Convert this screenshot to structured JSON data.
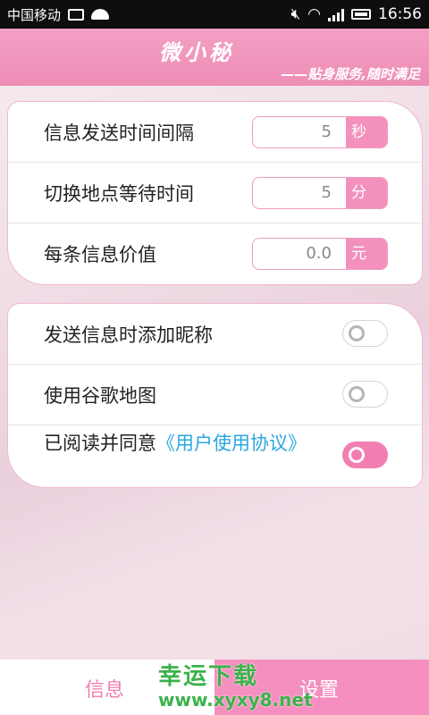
{
  "status_bar": {
    "carrier": "中国移动",
    "time": "16:56"
  },
  "header": {
    "brand": "微小秘",
    "slogan": "——贴身服务,随时满足"
  },
  "intervals": [
    {
      "label": "信息发送时间间隔",
      "value": "5",
      "unit": "秒"
    },
    {
      "label": "切换地点等待时间",
      "value": "5",
      "unit": "分"
    },
    {
      "label": "每条信息价值",
      "value": "0.0",
      "unit": "元"
    }
  ],
  "options": [
    {
      "label": "发送信息时添加昵称",
      "enabled": false
    },
    {
      "label": "使用谷歌地图",
      "enabled": false
    }
  ],
  "agreement": {
    "prefix": "已阅读并同意",
    "link": "《用户使用协议》",
    "enabled": true
  },
  "tabs": {
    "info": "信息",
    "settings": "设置"
  },
  "watermark": {
    "title": "幸运下载",
    "url": "www.xyxy8.net"
  },
  "colors": {
    "accent": "#f391bc",
    "link": "#29a7e1"
  }
}
